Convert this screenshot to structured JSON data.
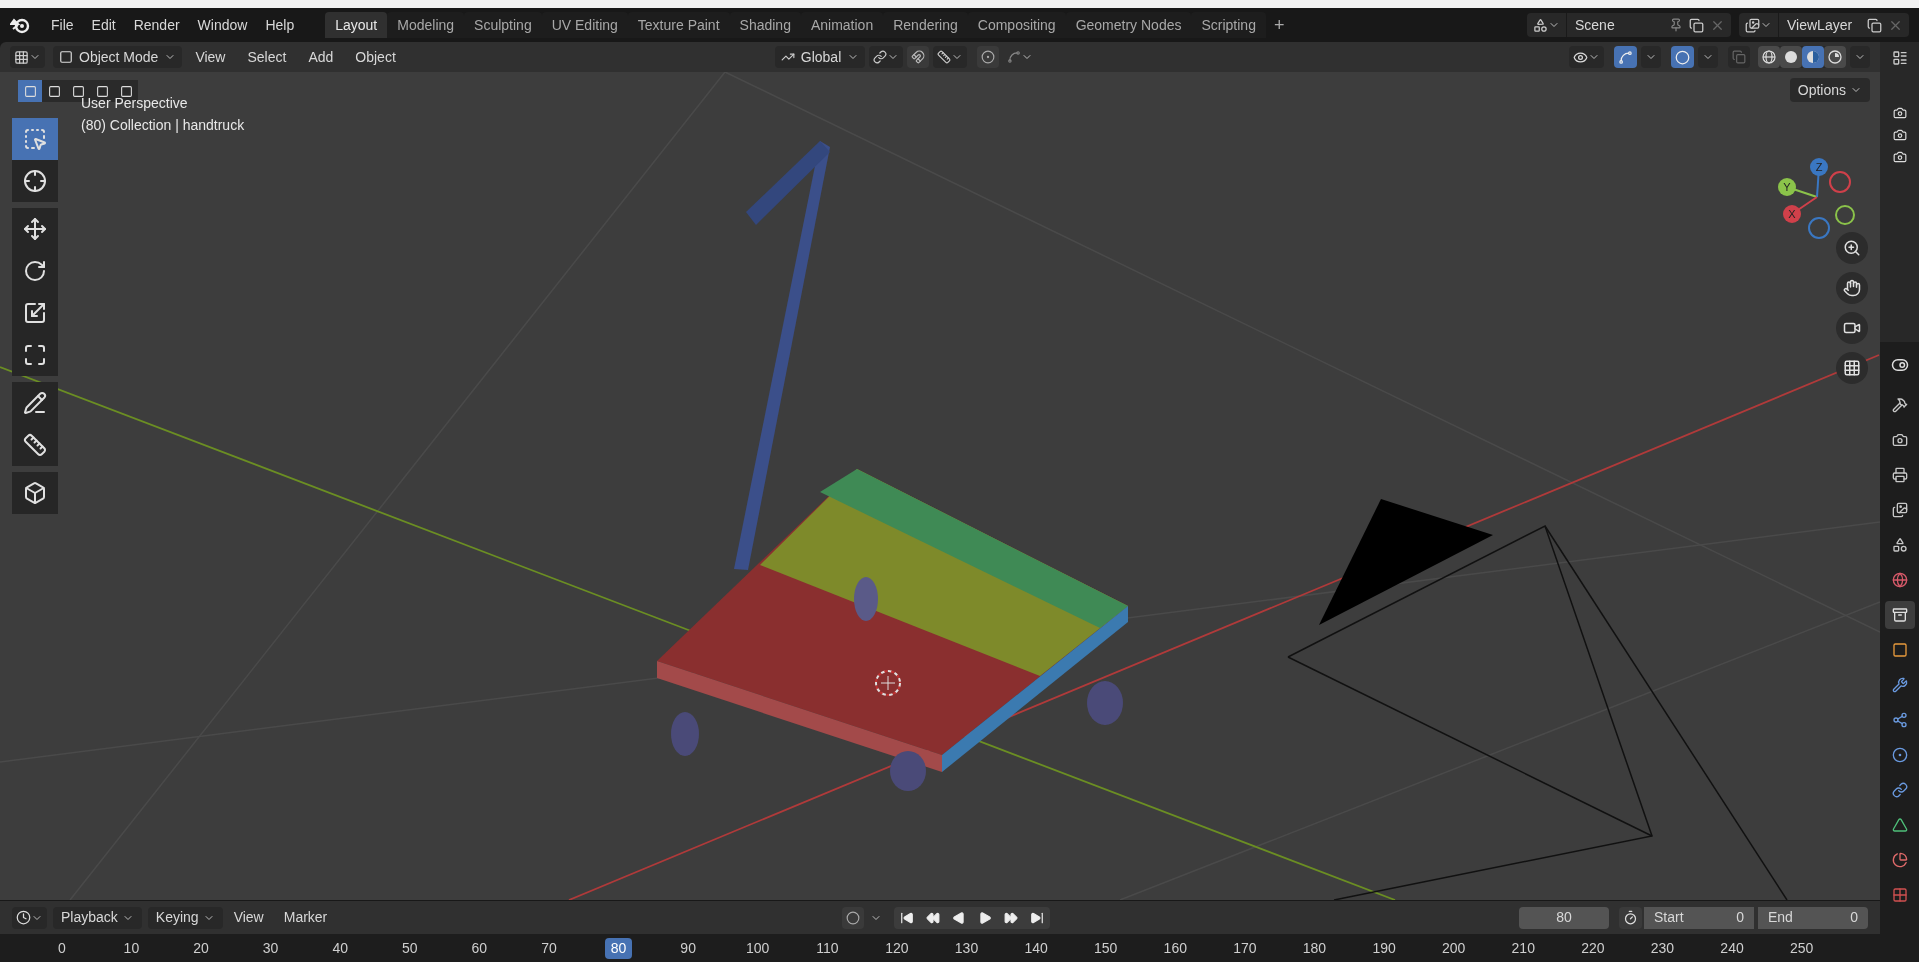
{
  "top_bar": {
    "menus": [
      "File",
      "Edit",
      "Render",
      "Window",
      "Help"
    ],
    "workspaces": [
      {
        "label": "Layout",
        "selected": true
      },
      {
        "label": "Modeling",
        "selected": false
      },
      {
        "label": "Sculpting",
        "selected": false
      },
      {
        "label": "UV Editing",
        "selected": false
      },
      {
        "label": "Texture Paint",
        "selected": false
      },
      {
        "label": "Shading",
        "selected": false
      },
      {
        "label": "Animation",
        "selected": false
      },
      {
        "label": "Rendering",
        "selected": false
      },
      {
        "label": "Compositing",
        "selected": false
      },
      {
        "label": "Geometry Nodes",
        "selected": false
      },
      {
        "label": "Scripting",
        "selected": false
      }
    ],
    "add_tab": "+",
    "scene": "Scene",
    "view_layer": "ViewLayer"
  },
  "viewport_header": {
    "mode": "Object Mode",
    "menus": [
      "View",
      "Select",
      "Add",
      "Object"
    ],
    "orientation": "Global",
    "snap_on": false,
    "proportional_on": false,
    "gizmos_on": true,
    "overlays_on": true,
    "shading": [
      {
        "kind": "wireframe",
        "selected": false
      },
      {
        "kind": "solid",
        "selected": false
      },
      {
        "kind": "material",
        "selected": true
      },
      {
        "kind": "rendered",
        "selected": false
      }
    ],
    "options": "Options"
  },
  "select_modes": [
    {
      "selected": true
    },
    {
      "selected": false
    },
    {
      "selected": false
    },
    {
      "selected": false
    },
    {
      "selected": false
    }
  ],
  "tools": [
    {
      "kind": "select",
      "selected": true
    },
    {
      "kind": "cursor",
      "selected": false
    },
    {
      "kind": "move",
      "selected": false
    },
    {
      "kind": "rotate",
      "selected": false
    },
    {
      "kind": "scale",
      "selected": false
    },
    {
      "kind": "transform",
      "selected": false
    },
    {
      "kind": "annotate",
      "selected": false
    },
    {
      "kind": "measure",
      "selected": false
    },
    {
      "kind": "add_cube",
      "selected": false
    }
  ],
  "viewport": {
    "kind": "picture",
    "info": [
      "User Perspective",
      "(80) Collection | handtruck"
    ],
    "axes": [
      "Z",
      "Y",
      "X"
    ]
  },
  "timeline": {
    "menus": [
      {
        "label": "Playback",
        "kind": "dropdown"
      },
      {
        "label": "Keying",
        "kind": "dropdown"
      },
      {
        "label": "View",
        "kind": "menu"
      },
      {
        "label": "Marker",
        "kind": "menu"
      }
    ],
    "current_frame": "80",
    "start_label": "Start",
    "start": "0",
    "end_label": "End",
    "end": "0",
    "ticks": [
      {
        "label": "0",
        "selected": false
      },
      {
        "label": "10",
        "selected": false
      },
      {
        "label": "20",
        "selected": false
      },
      {
        "label": "30",
        "selected": false
      },
      {
        "label": "40",
        "selected": false
      },
      {
        "label": "50",
        "selected": false
      },
      {
        "label": "60",
        "selected": false
      },
      {
        "label": "70",
        "selected": false
      },
      {
        "label": "80",
        "selected": true
      },
      {
        "label": "90",
        "selected": false
      },
      {
        "label": "100",
        "selected": false
      },
      {
        "label": "110",
        "selected": false
      },
      {
        "label": "120",
        "selected": false
      },
      {
        "label": "130",
        "selected": false
      },
      {
        "label": "140",
        "selected": false
      },
      {
        "label": "150",
        "selected": false
      },
      {
        "label": "160",
        "selected": false
      },
      {
        "label": "170",
        "selected": false
      },
      {
        "label": "180",
        "selected": false
      },
      {
        "label": "190",
        "selected": false
      },
      {
        "label": "200",
        "selected": false
      },
      {
        "label": "210",
        "selected": false
      },
      {
        "label": "220",
        "selected": false
      },
      {
        "label": "230",
        "selected": false
      },
      {
        "label": "240",
        "selected": false
      },
      {
        "label": "250",
        "selected": false
      }
    ]
  },
  "properties_tabs": [
    {
      "kind": "tool",
      "selected": false
    },
    {
      "kind": "render",
      "selected": false
    },
    {
      "kind": "output",
      "selected": false
    },
    {
      "kind": "view_layer",
      "selected": false
    },
    {
      "kind": "scene",
      "selected": false
    },
    {
      "kind": "world",
      "selected": false
    },
    {
      "kind": "collection",
      "selected": true
    },
    {
      "kind": "object",
      "selected": false
    },
    {
      "kind": "modifiers",
      "selected": false
    },
    {
      "kind": "particles",
      "selected": false
    },
    {
      "kind": "physics",
      "selected": false
    },
    {
      "kind": "constraints",
      "selected": false
    },
    {
      "kind": "data",
      "selected": false
    },
    {
      "kind": "material",
      "selected": false
    },
    {
      "kind": "texture",
      "selected": false
    }
  ]
}
